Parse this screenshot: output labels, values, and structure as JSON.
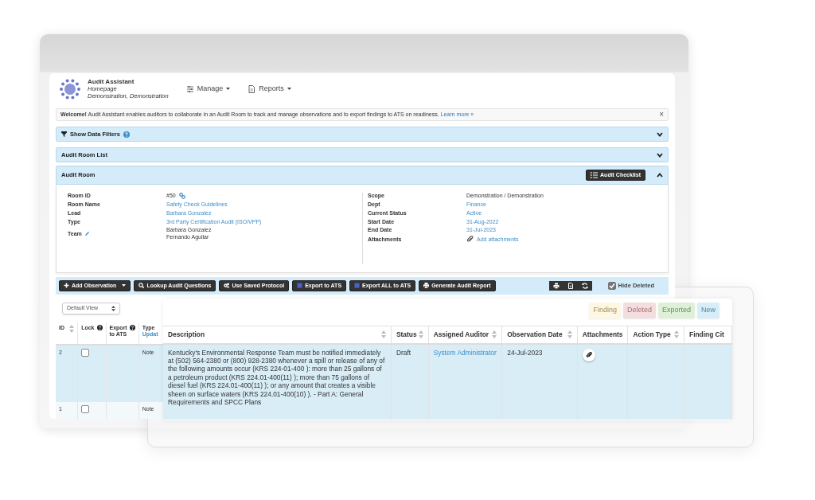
{
  "header": {
    "app_title": "Audit Assistant",
    "subtitle": "Homepage",
    "context": "Demonstration, Demonstration"
  },
  "nav": [
    {
      "label": "Manage"
    },
    {
      "label": "Reports"
    }
  ],
  "welcome": {
    "text": "**Welcome!** Audit Assistant enables auditors to collaborate in an Audit Room to track and manage observations and to export findings to ATS on readiness.",
    "link": "Learn more »",
    "close": "×"
  },
  "panels": [
    {
      "title": "Show Data Filters",
      "kind": "filter",
      "expanded": false
    },
    {
      "title": "Audit Room List",
      "kind": "plain",
      "expanded": false
    }
  ],
  "audit_room": {
    "title": "Audit Room",
    "expanded": true,
    "checklist_button": "Audit Checklist",
    "left_fields": [
      {
        "label": "Room ID",
        "kind": "id",
        "values": [
          "#50"
        ]
      },
      {
        "label": "Room Name",
        "kind": "link",
        "values": [
          "Safety Check Guidelines"
        ]
      },
      {
        "label": "Lead",
        "kind": "link",
        "values": [
          "Barbara Gonzalez"
        ]
      },
      {
        "label": "Type",
        "kind": "link",
        "values": [
          "3rd Party Certification Audit (ISO/VPP)"
        ]
      },
      {
        "label": "Team",
        "kind": "team",
        "values": [
          "Barbara Gonzalez",
          "Fernando Aguilar"
        ]
      }
    ],
    "right_fields": [
      {
        "label": "Scope",
        "kind": "text",
        "values": [
          "Demonstration / Demonstration"
        ]
      },
      {
        "label": "Dept",
        "kind": "link",
        "values": [
          "Finance"
        ]
      },
      {
        "label": "Current Status",
        "kind": "link",
        "values": [
          "Active"
        ]
      },
      {
        "label": "Start Date",
        "kind": "link",
        "values": [
          "31-Aug-2022"
        ]
      },
      {
        "label": "End Date",
        "kind": "link",
        "values": [
          "31-Jul-2023"
        ]
      },
      {
        "label": "Attachments",
        "kind": "attachment",
        "values": [
          "Add attachments"
        ]
      }
    ]
  },
  "toolbar": {
    "buttons": [
      {
        "label": "Add Observation",
        "caret": true
      },
      {
        "label": "Lookup Audit Questions",
        "caret": false
      },
      {
        "label": "Use Saved Protocol",
        "caret": false
      },
      {
        "label": "Export to ATS",
        "caret": false
      },
      {
        "label": "Export ALL to ATS",
        "caret": false
      },
      {
        "label": "Generate Audit Report",
        "caret": false
      }
    ],
    "hide_deleted": {
      "label": "Hide Deleted",
      "checked": true
    }
  },
  "view_select": "Default View",
  "table": {
    "columns": [
      {
        "label": "ID",
        "help": false,
        "sortable": true
      },
      {
        "label": "Lock",
        "help": true,
        "sortable": false
      },
      {
        "label": "Export to ATS",
        "help": true,
        "sortable": false
      },
      {
        "label": "Type",
        "help": false,
        "sortable": false,
        "link": "Updat"
      }
    ],
    "rows": [
      {
        "id": "2",
        "locked": false,
        "type": "Note"
      },
      {
        "id": "1",
        "locked": false,
        "type": "Note"
      }
    ]
  },
  "detail": {
    "legend": [
      {
        "label": "Finding",
        "color": "#fcf8e3"
      },
      {
        "label": "Deleted",
        "color": "#f2dede"
      },
      {
        "label": "Exported",
        "color": "#dff0d8"
      },
      {
        "label": "New",
        "color": "#d9edf7"
      }
    ],
    "columns": [
      {
        "label": "Description",
        "sortable": true
      },
      {
        "label": "Status",
        "sortable": true
      },
      {
        "label": "Assigned Auditor",
        "sortable": true
      },
      {
        "label": "Observation Date",
        "sortable": true
      },
      {
        "label": "Attachments",
        "sortable": false
      },
      {
        "label": "Action Type",
        "sortable": true
      },
      {
        "label": "Finding Cit",
        "sortable": false
      }
    ],
    "rows": [
      {
        "description": "Kentucky's Environmental Response Team must be notified immediately at (502) 564-2380 or (800) 928-2380 whenever a spill or release of any of the following amounts occur (KRS 224-01-400 ): more than 25 gallons of a petroleum product (KRS 224.01-400(11) ); more than 75 gallons of diesel fuel (KRS 224.01-400(11) ); or any amount that creates a visible sheen on surface waters (KRS 224.01-400(10) ). - Part A: General Requirements and SPCC Plans",
        "status": "Draft",
        "auditor": "System Administrator",
        "date": "24-Jul-2023",
        "attachment": true
      }
    ]
  }
}
